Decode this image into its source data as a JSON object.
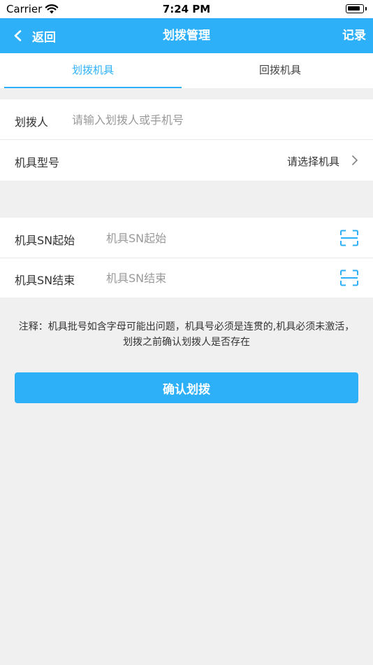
{
  "status_bar": {
    "carrier": "Carrier",
    "time": "7:24 PM"
  },
  "nav": {
    "back_label": "返回",
    "title": "划拨管理",
    "right_label": "记录"
  },
  "tabs": [
    {
      "label": "划拨机具",
      "active": true
    },
    {
      "label": "回拨机具",
      "active": false
    }
  ],
  "form": {
    "assignee": {
      "label": "划拨人",
      "placeholder": "请输入划拨人或手机号",
      "value": ""
    },
    "model": {
      "label": "机具型号",
      "value": "请选择机具"
    },
    "sn_start": {
      "label": "机具SN起始",
      "placeholder": "机具SN起始",
      "value": ""
    },
    "sn_end": {
      "label": "机具SN结束",
      "placeholder": "机具SN结束",
      "value": ""
    }
  },
  "note": "注释：机具批号如含字母可能出问题，机具号必须是连贯的,机具必须未激活，划拨之前确认划拨人是否存在",
  "confirm_label": "确认划拨",
  "colors": {
    "accent": "#2eb0f8",
    "background": "#f0f0f0"
  },
  "icons": [
    "wifi-icon",
    "battery-icon",
    "back-chevron-icon",
    "chevron-right-icon",
    "scan-icon"
  ]
}
